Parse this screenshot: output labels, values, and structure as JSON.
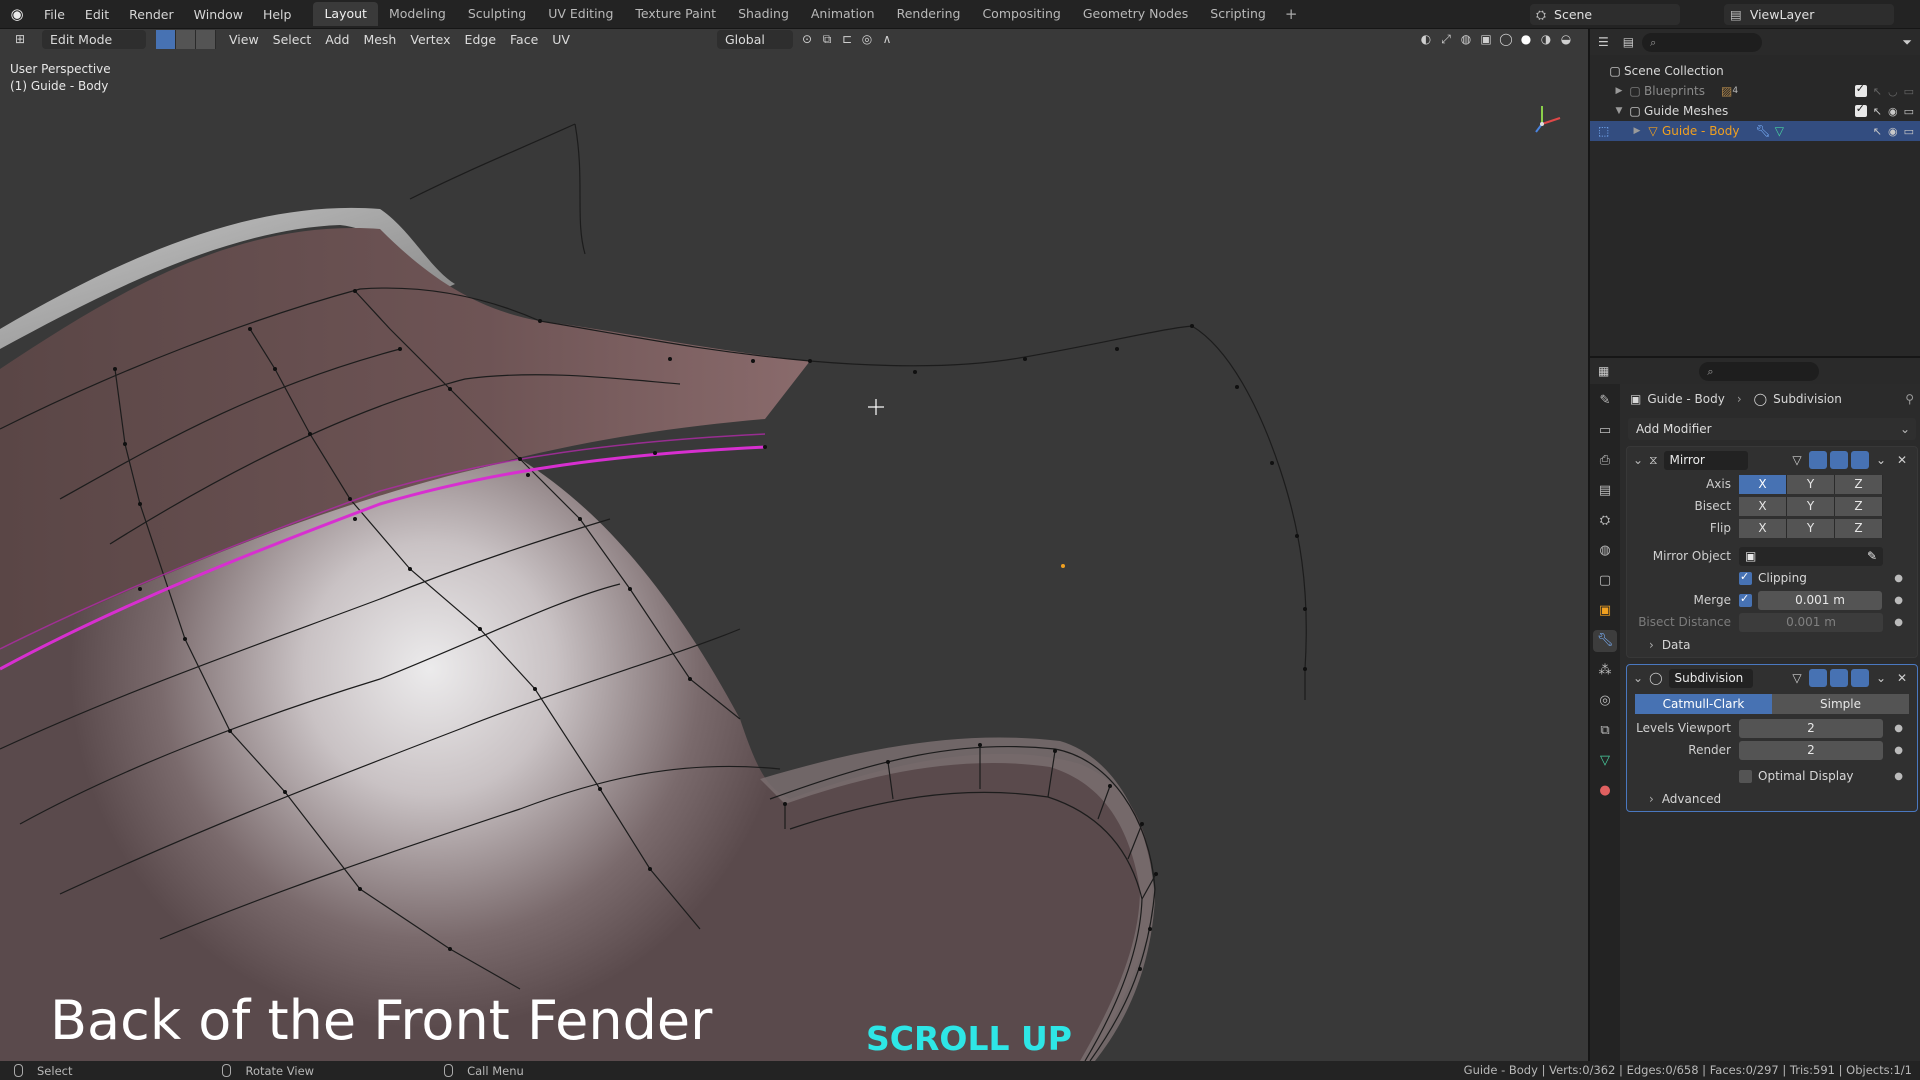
{
  "menu": [
    "File",
    "Edit",
    "Render",
    "Window",
    "Help"
  ],
  "workspaces": [
    "Layout",
    "Modeling",
    "Sculpting",
    "UV Editing",
    "Texture Paint",
    "Shading",
    "Animation",
    "Rendering",
    "Compositing",
    "Geometry Nodes",
    "Scripting"
  ],
  "active_workspace": "Layout",
  "scene": "Scene",
  "view_layer": "ViewLayer",
  "viewport": {
    "mode": "Edit Mode",
    "menus": [
      "View",
      "Select",
      "Add",
      "Mesh",
      "Vertex",
      "Edge",
      "Face",
      "UV"
    ],
    "transform_orientation": "Global",
    "perspective_label": "User Perspective",
    "object_label": "(1) Guide - Body"
  },
  "outliner": {
    "root": "Scene Collection",
    "items": [
      {
        "name": "Blueprints",
        "count": "4"
      },
      {
        "name": "Guide Meshes"
      },
      {
        "name": "Guide - Body"
      }
    ]
  },
  "properties": {
    "breadcrumb_object": "Guide - Body",
    "breadcrumb_modifier": "Subdivision",
    "add_modifier": "Add Modifier",
    "mirror": {
      "name": "Mirror",
      "axis_label": "Axis",
      "bisect_label": "Bisect",
      "flip_label": "Flip",
      "x": "X",
      "y": "Y",
      "z": "Z",
      "mirror_object_label": "Mirror Object",
      "clipping_label": "Clipping",
      "merge_label": "Merge",
      "merge_value": "0.001 m",
      "bisect_distance_label": "Bisect Distance",
      "bisect_distance_value": "0.001 m",
      "data_label": "Data"
    },
    "subdivision": {
      "name": "Subdivision",
      "catmull": "Catmull-Clark",
      "simple": "Simple",
      "levels_viewport_label": "Levels Viewport",
      "levels_viewport": "2",
      "render_label": "Render",
      "render": "2",
      "optimal_display": "Optimal Display",
      "advanced": "Advanced"
    }
  },
  "overlay": {
    "title": "Back of the Front Fender",
    "scroll_hint": "SCROLL UP"
  },
  "status": {
    "select": "Select",
    "rotate": "Rotate View",
    "call_menu": "Call Menu",
    "stats": "Guide - Body | Verts:0/362 | Edges:0/658 | Faces:0/297 | Tris:591 | Objects:1/1"
  },
  "colors": {
    "accent": "#4772b3",
    "selection_edge": "#d72fd0",
    "overlay_cyan": "#2ee6e6"
  }
}
